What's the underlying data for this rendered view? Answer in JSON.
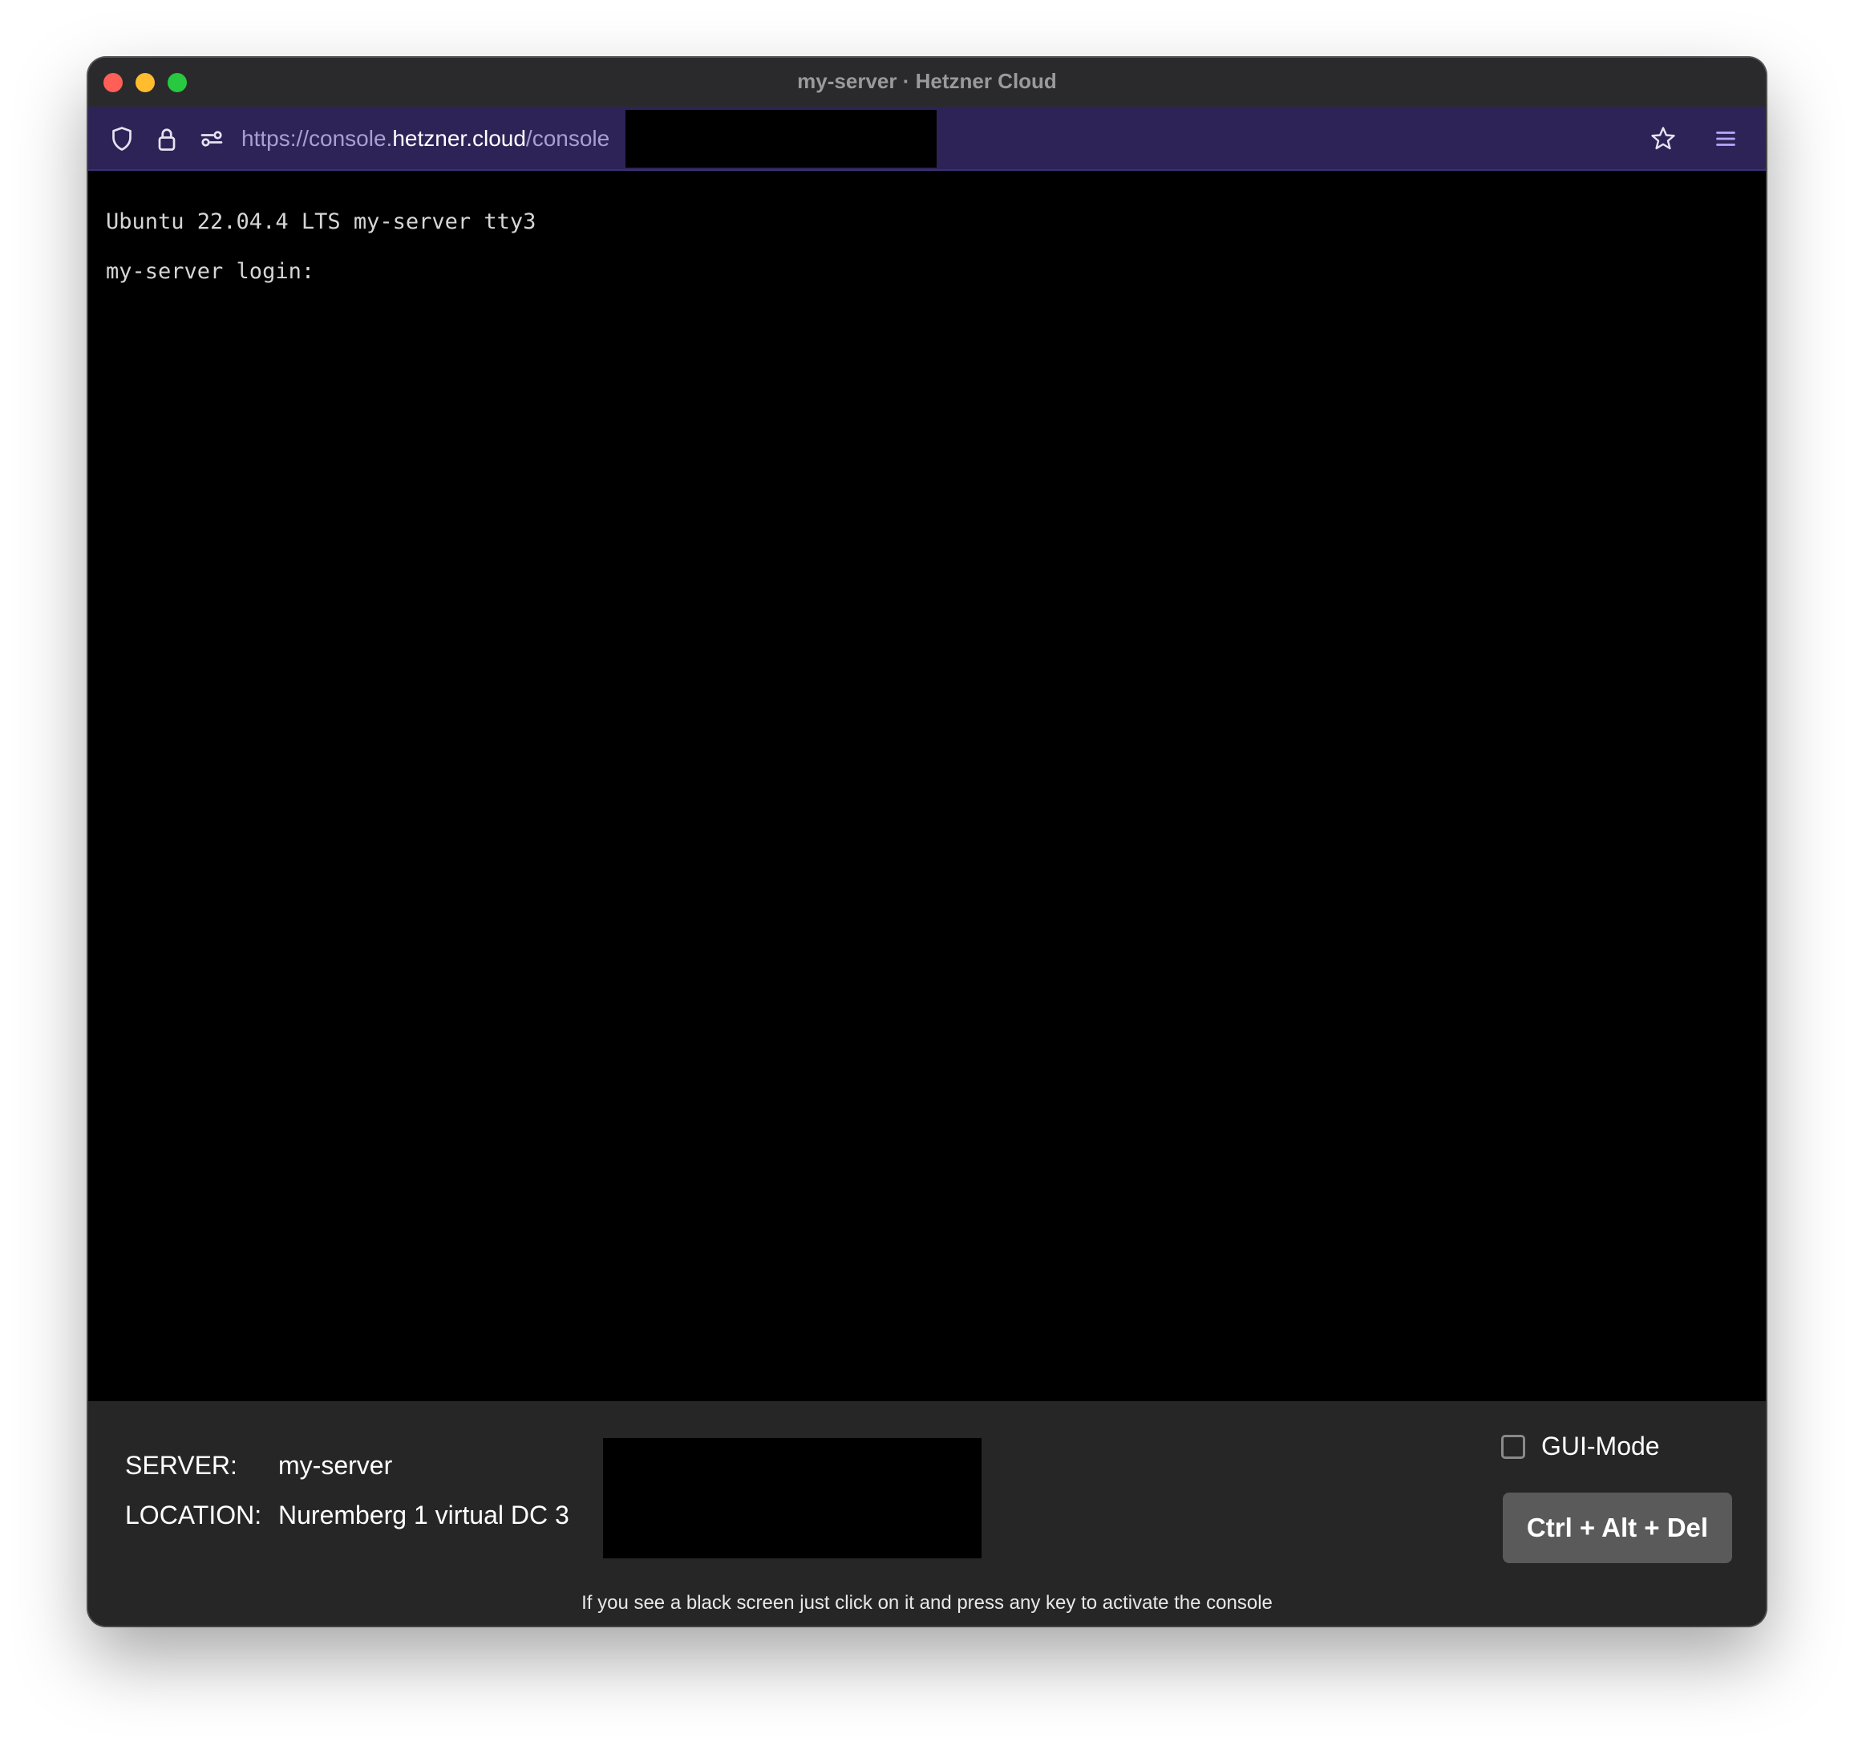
{
  "window": {
    "title": "my-server · Hetzner Cloud"
  },
  "urlbar": {
    "url_prefix": "https://console.",
    "url_host": "hetzner.cloud",
    "url_path": "/console",
    "icons": [
      "shield-icon",
      "lock-icon",
      "permissions-icon",
      "star-icon",
      "menu-icon"
    ]
  },
  "terminal": {
    "lines": [
      "Ubuntu 22.04.4 LTS my-server tty3",
      "my-server login:"
    ]
  },
  "footer": {
    "server_label": "SERVER:",
    "server_value": "my-server",
    "location_label": "LOCATION:",
    "location_value": "Nuremberg 1 virtual DC 3",
    "gui_mode_label": "GUI-Mode",
    "gui_mode_checked": false,
    "cad_button_label": "Ctrl + Alt + Del",
    "hint": "If you see a black screen just click on it and press any key to activate the console"
  },
  "colors": {
    "urlbar_bg": "#2e2357",
    "footer_bg": "#262626",
    "terminal_bg": "#000000",
    "button_bg": "#5a5a5a"
  }
}
